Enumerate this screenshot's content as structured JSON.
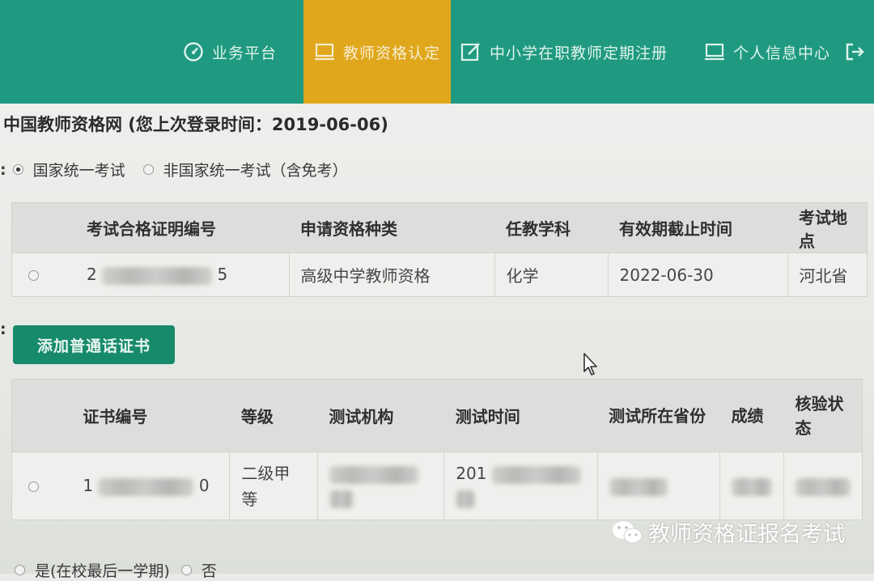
{
  "nav": {
    "items": [
      {
        "label": "业务平台",
        "icon": "dashboard-icon"
      },
      {
        "label": "教师资格认定",
        "icon": "monitor-icon",
        "active": true
      },
      {
        "label": "中小学在职教师定期注册",
        "icon": "edit-icon"
      },
      {
        "label": "个人信息中心",
        "icon": "monitor-icon"
      }
    ],
    "colors": {
      "bar": "#1f9a80",
      "active": "#e0a71c"
    }
  },
  "page": {
    "title": "中国教师资格网 (您上次登录时间：2019-06-06)",
    "exam_type": {
      "colon": ":",
      "options": [
        "国家统一考试",
        "非国家统一考试（含免考）"
      ],
      "selected": 0
    }
  },
  "exam_table": {
    "headers": [
      "考试合格证明编号",
      "申请资格种类",
      "任教学科",
      "有效期截止时间",
      "考试地点"
    ],
    "row": {
      "cert_no_prefix": "2",
      "cert_no_suffix": "5",
      "qualification": "高级中学教师资格",
      "subject": "化学",
      "expiry": "2022-06-30",
      "location": "河北省"
    }
  },
  "mandarin": {
    "colon": ":",
    "add_button": "添加普通话证书",
    "headers": [
      "证书编号",
      "等级",
      "测试机构",
      "测试时间",
      "测试所在省份",
      "成绩",
      "核验状态"
    ],
    "row": {
      "cert_no_prefix": "1",
      "cert_no_suffix": "0",
      "level": "二级甲等",
      "test_time_prefix": "201"
    }
  },
  "bottom": {
    "option_yes": "是(在校最后一学期)",
    "option_no": "否"
  },
  "watermark": "教师资格证报名考试"
}
